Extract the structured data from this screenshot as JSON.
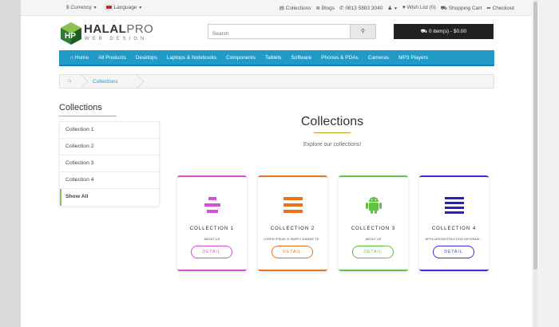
{
  "topbar": {
    "currency": "$ Currency",
    "language": "Language",
    "links": [
      "Collections",
      "Blogs",
      "0813 5883 3040",
      "",
      "Wish List (0)",
      "Shopping Cart",
      "Checkout"
    ]
  },
  "header": {
    "logo_brand_a": "HALAL",
    "logo_brand_b": "PRO",
    "logo_sub": "WEB DESIGN",
    "search_placeholder": "Search",
    "cart_label": "0 item(s) - $0.00"
  },
  "nav": {
    "items": [
      "Home",
      "All Products",
      "Desktops",
      "Laptops & Notebooks",
      "Components",
      "Tablets",
      "Software",
      "Phones & PDAs",
      "Cameras",
      "MP3 Players"
    ]
  },
  "breadcrumb": {
    "current": "Collections"
  },
  "sidebar": {
    "title": "Collections",
    "items": [
      "Collection 1",
      "Collection 2",
      "Collection 3",
      "Collection 4",
      "Show All"
    ]
  },
  "main": {
    "title": "Collections",
    "subtitle": "Explore our collections!",
    "cards": [
      {
        "name": "COLLECTION 1",
        "desc": "ABOUT US",
        "button": "DETAIL",
        "color": "#d64fd6"
      },
      {
        "name": "COLLECTION 2",
        "desc": "LOREM IPSUM IS SIMPLY DUMMY TE...",
        "button": "DETAIL",
        "color": "#e9731b"
      },
      {
        "name": "COLLECTION 3",
        "desc": "ABOUT US",
        "button": "DETAIL",
        "color": "#5ec442"
      },
      {
        "name": "COLLECTION 4",
        "desc": "AFFILIATE/INSTRUCTION INFORMAT...",
        "button": "DETAIL",
        "color": "#3a2fd6"
      }
    ]
  },
  "colors": {
    "nav": "#229ac8",
    "accent_green": "#8cc152",
    "title_underline": "#c9a21a"
  },
  "icons": [
    "currency-icon",
    "flag-icon",
    "collections-icon",
    "blogs-icon",
    "phone-icon",
    "user-icon",
    "heart-icon",
    "cart-icon",
    "checkout-icon",
    "search-icon",
    "home-icon",
    "list-icon",
    "bars-icon",
    "android-icon",
    "menu-icon"
  ]
}
